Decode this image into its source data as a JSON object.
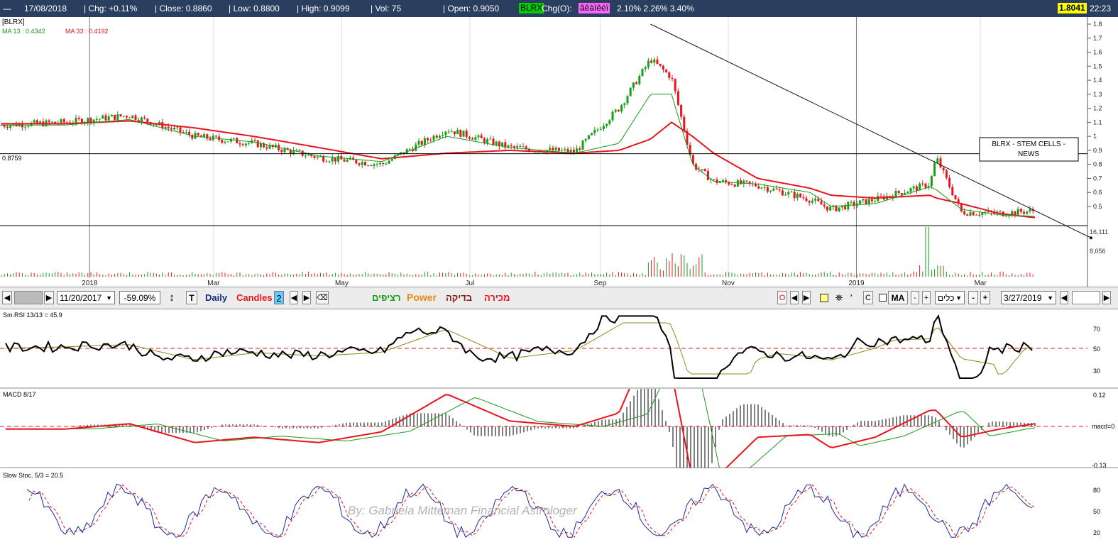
{
  "header": {
    "date": "17/08/2018",
    "chg": "| Chg: +0.11%",
    "close": "| Close: 0.8860",
    "low": "| Low: 0.8800",
    "high": "| High: 0.9099",
    "vol": "| Vol: 75",
    "open": "| Open: 0.9050",
    "symbol": "BLRX",
    "chgo_label": "Chg(O):",
    "chgo_box": "âêàìêéï",
    "chgo_values": "2.10% 2.26% 3.40%",
    "last_price": "1.8041",
    "time": "22:23",
    "colors": {
      "bar": "#2a3f5f",
      "symbol_bg": "#00cc00",
      "chgo_bg": "#ff66ff",
      "last_bg": "#ffff00"
    }
  },
  "toolbar": {
    "start_date": "11/20/2017",
    "percent": "-59.09%",
    "t_label": "T",
    "period": "Daily",
    "style": "Candles",
    "style_num": "2",
    "hebrew_continuous": "רציפים",
    "power": "Power",
    "hebrew_check": "בדיקה",
    "hebrew_sell": "מכירה",
    "o_label": "O",
    "c_label": "C",
    "ma_label": "MA",
    "hebrew_tools": "כלים",
    "end_date": "3/27/2019"
  },
  "main_chart": {
    "ticker_label": "[BLRX]",
    "ma13_label": "MA 13 : 0.4342",
    "ma33_label": "MA 33 : 0.4192",
    "hline_label": "0.8759",
    "hline_value": 0.8759,
    "annotation": [
      "BLRX - STEM CELLS -",
      "NEWS"
    ],
    "watermark": "By:  Gabriela Mitteman Financial Astrologer",
    "y_ticks": [
      "1.8",
      "1.7",
      "1.6",
      "1.5",
      "1.4",
      "1.3",
      "1.2",
      "1.1",
      "1",
      "0.9",
      "0.8",
      "0.7",
      "0.6",
      "0.5"
    ],
    "x_labels": [
      "2018",
      "Mar",
      "May",
      "Jul",
      "Sep",
      "Nov",
      "2019",
      "Mar"
    ],
    "volume_ticks": [
      "16,111",
      "8,056"
    ]
  },
  "rsi_panel": {
    "label": "Sm.RSI 13/13 = 45.9",
    "ticks": [
      "70",
      "50",
      "30"
    ]
  },
  "macd_panel": {
    "label": "MACD 8/17",
    "ticks": [
      "0.12",
      "macd=0",
      "-0.13"
    ]
  },
  "stoch_panel": {
    "label": "Slow Stoc. 5/3 = 20.5",
    "ticks": [
      "80",
      "50",
      "20"
    ]
  },
  "chart_data": {
    "type": "line",
    "title": "",
    "x": [
      "2017-11-20",
      "2017-12-20",
      "2018-01-20",
      "2018-02-20",
      "2018-03-20",
      "2018-04-20",
      "2018-05-20",
      "2018-06-20",
      "2018-07-20",
      "2018-08-20",
      "2018-09-10",
      "2018-09-25",
      "2018-10-05",
      "2018-10-15",
      "2018-10-25",
      "2018-11-15",
      "2018-12-10",
      "2018-12-20",
      "2019-01-10",
      "2019-02-05",
      "2019-02-08",
      "2019-02-20",
      "2019-03-10",
      "2019-03-27"
    ],
    "series": [
      {
        "name": "MA 13",
        "values": [
          1.08,
          1.08,
          1.12,
          1.0,
          0.96,
          0.86,
          0.82,
          1.0,
          0.92,
          0.88,
          0.95,
          1.3,
          1.3,
          0.8,
          0.68,
          0.66,
          0.6,
          0.5,
          0.52,
          0.64,
          0.62,
          0.48,
          0.44,
          0.43
        ]
      },
      {
        "name": "MA 33",
        "values": [
          1.09,
          1.09,
          1.11,
          1.06,
          1.0,
          0.92,
          0.84,
          0.88,
          0.9,
          0.88,
          0.9,
          0.98,
          1.1,
          1.0,
          0.88,
          0.7,
          0.63,
          0.58,
          0.56,
          0.58,
          0.56,
          0.52,
          0.45,
          0.42
        ]
      }
    ],
    "close": [
      1.08,
      1.1,
      1.15,
      1.0,
      0.95,
      0.85,
      0.8,
      1.05,
      0.92,
      0.89,
      1.2,
      1.55,
      1.42,
      0.8,
      0.68,
      0.65,
      0.55,
      0.48,
      0.55,
      0.66,
      0.85,
      0.46,
      0.45,
      0.47
    ],
    "trendline": [
      [
        "2018-09-25",
        1.8
      ],
      [
        "2019-03-27",
        0.47
      ]
    ],
    "ylim": [
      0.4,
      1.82
    ]
  }
}
